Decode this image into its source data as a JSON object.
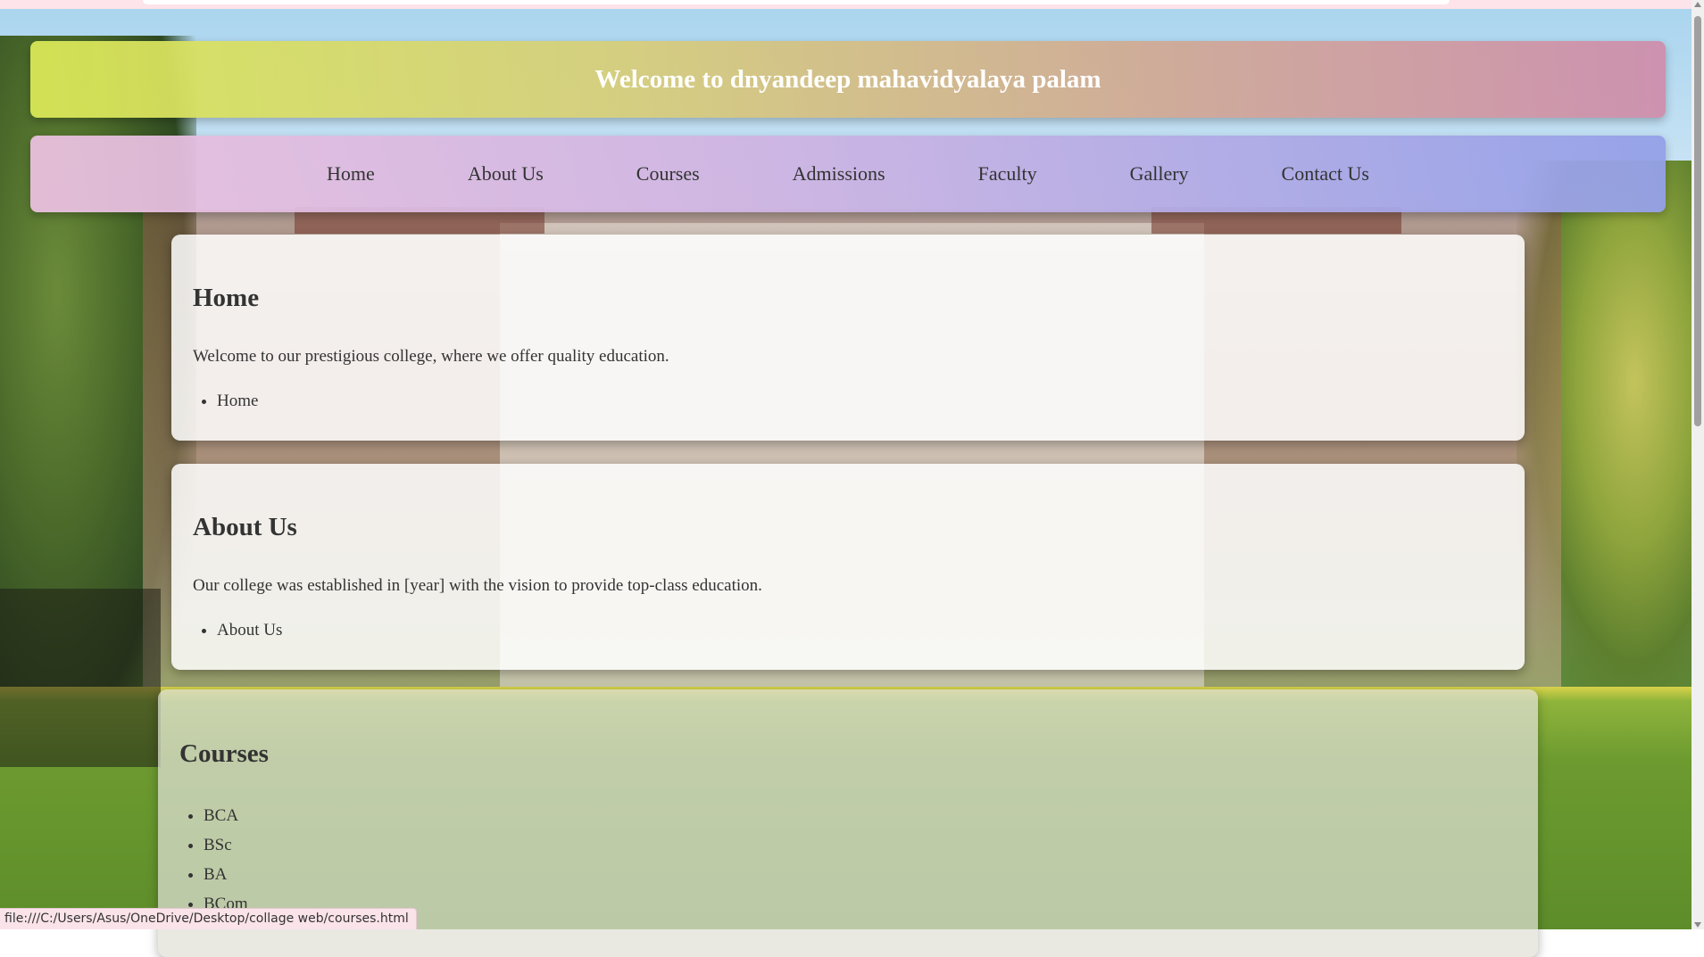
{
  "page": {
    "banner_title": "Welcome to dnyandeep mahavidyalaya palam"
  },
  "nav": {
    "items": [
      {
        "label": "Home"
      },
      {
        "label": "About Us"
      },
      {
        "label": "Courses"
      },
      {
        "label": "Admissions"
      },
      {
        "label": "Faculty"
      },
      {
        "label": "Gallery"
      },
      {
        "label": "Contact Us"
      }
    ]
  },
  "sections": {
    "home": {
      "heading": "Home",
      "text": "Welcome to our prestigious college, where we offer quality education.",
      "list": [
        "Home"
      ]
    },
    "about": {
      "heading": "About Us",
      "text": "Our college was established in [year] with the vision to provide top-class education.",
      "list": [
        "About Us"
      ]
    },
    "courses": {
      "heading": "Courses",
      "list": [
        "BCA",
        "BSc",
        "BA",
        "BCom"
      ]
    }
  },
  "status_bar": {
    "url": "file:///C:/Users/Asus/OneDrive/Desktop/collage web/courses.html"
  }
}
